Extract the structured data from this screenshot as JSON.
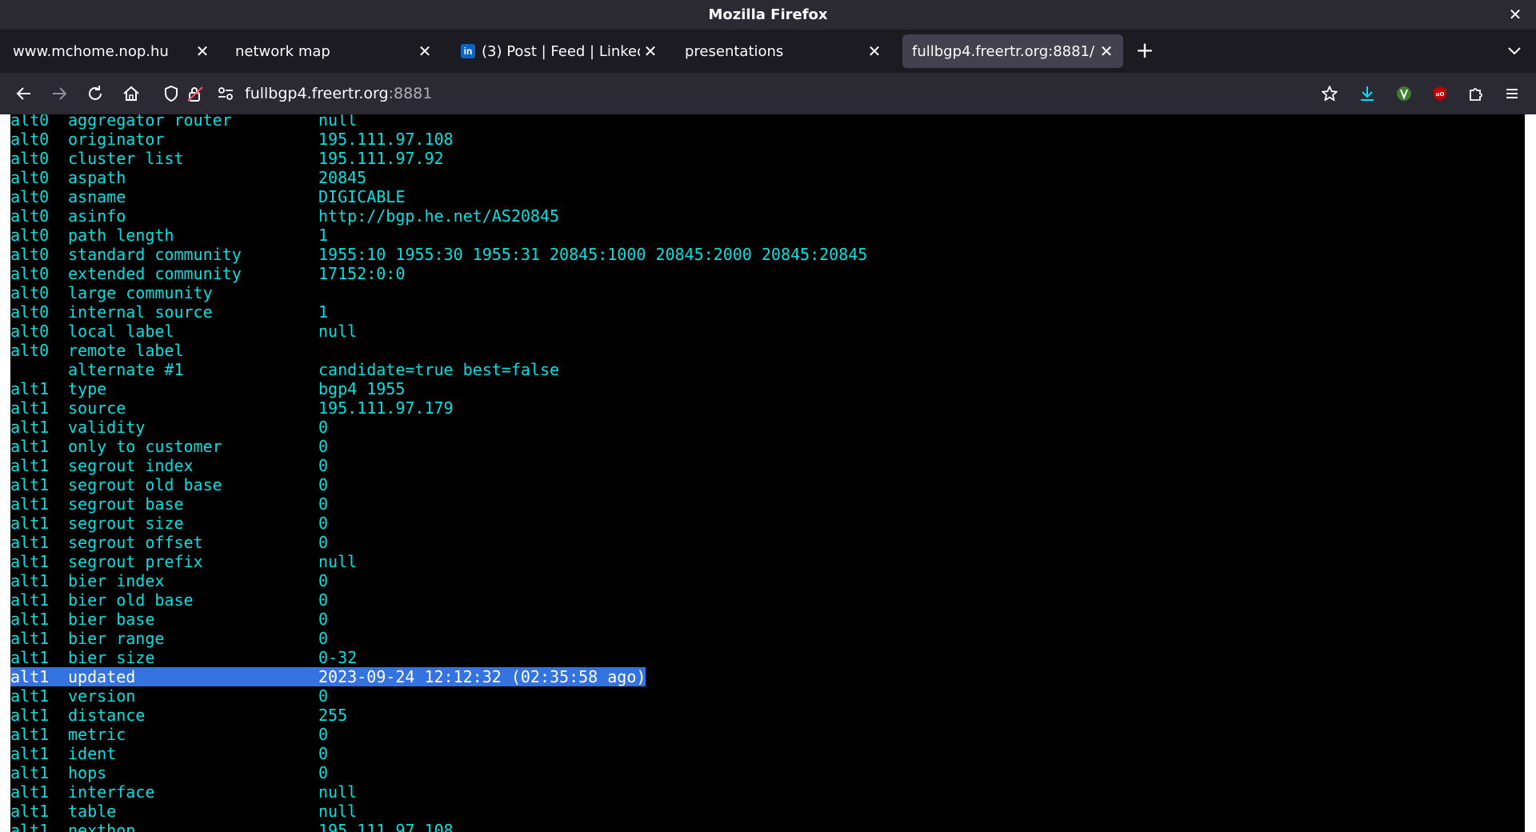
{
  "window": {
    "title": "Mozilla Firefox"
  },
  "tabs": [
    {
      "label": "www.mchome.nop.hu"
    },
    {
      "label": "network map"
    },
    {
      "label": "(3) Post | Feed | LinkedIn",
      "favicon": "in"
    },
    {
      "label": "presentations"
    },
    {
      "label": "fullbgp4.freertr.org:8881/",
      "active": true
    }
  ],
  "address": {
    "host": "fullbgp4.freertr.org",
    "port": ":8881"
  },
  "theme": {
    "terminal_fg": "#00e0e0",
    "terminal_bg": "#000000",
    "selection": "#3574e0"
  },
  "terminal": {
    "lines": [
      {
        "prefix": "alt0",
        "key": "aggregator router",
        "value": "null"
      },
      {
        "prefix": "alt0",
        "key": "originator",
        "value": "195.111.97.108"
      },
      {
        "prefix": "alt0",
        "key": "cluster list",
        "value": "195.111.97.92"
      },
      {
        "prefix": "alt0",
        "key": "aspath",
        "value": "20845"
      },
      {
        "prefix": "alt0",
        "key": "asname",
        "value": "DIGICABLE"
      },
      {
        "prefix": "alt0",
        "key": "asinfo",
        "value": "http://bgp.he.net/AS20845"
      },
      {
        "prefix": "alt0",
        "key": "path length",
        "value": "1"
      },
      {
        "prefix": "alt0",
        "key": "standard community",
        "value": "1955:10 1955:30 1955:31 20845:1000 20845:2000 20845:20845"
      },
      {
        "prefix": "alt0",
        "key": "extended community",
        "value": "17152:0:0"
      },
      {
        "prefix": "alt0",
        "key": "large community",
        "value": ""
      },
      {
        "prefix": "alt0",
        "key": "internal source",
        "value": "1"
      },
      {
        "prefix": "alt0",
        "key": "local label",
        "value": "null"
      },
      {
        "prefix": "alt0",
        "key": "remote label",
        "value": ""
      },
      {
        "prefix": "",
        "key": "alternate #1",
        "value": "candidate=true best=false"
      },
      {
        "prefix": "alt1",
        "key": "type",
        "value": "bgp4 1955"
      },
      {
        "prefix": "alt1",
        "key": "source",
        "value": "195.111.97.179"
      },
      {
        "prefix": "alt1",
        "key": "validity",
        "value": "0"
      },
      {
        "prefix": "alt1",
        "key": "only to customer",
        "value": "0"
      },
      {
        "prefix": "alt1",
        "key": "segrout index",
        "value": "0"
      },
      {
        "prefix": "alt1",
        "key": "segrout old base",
        "value": "0"
      },
      {
        "prefix": "alt1",
        "key": "segrout base",
        "value": "0"
      },
      {
        "prefix": "alt1",
        "key": "segrout size",
        "value": "0"
      },
      {
        "prefix": "alt1",
        "key": "segrout offset",
        "value": "0"
      },
      {
        "prefix": "alt1",
        "key": "segrout prefix",
        "value": "null"
      },
      {
        "prefix": "alt1",
        "key": "bier index",
        "value": "0"
      },
      {
        "prefix": "alt1",
        "key": "bier old base",
        "value": "0"
      },
      {
        "prefix": "alt1",
        "key": "bier base",
        "value": "0"
      },
      {
        "prefix": "alt1",
        "key": "bier range",
        "value": "0"
      },
      {
        "prefix": "alt1",
        "key": "bier size",
        "value": "0-32"
      },
      {
        "prefix": "alt1",
        "key": "updated",
        "value": "2023-09-24 12:12:32 (02:35:58 ago)",
        "selected": true
      },
      {
        "prefix": "alt1",
        "key": "version",
        "value": "0"
      },
      {
        "prefix": "alt1",
        "key": "distance",
        "value": "255"
      },
      {
        "prefix": "alt1",
        "key": "metric",
        "value": "0"
      },
      {
        "prefix": "alt1",
        "key": "ident",
        "value": "0"
      },
      {
        "prefix": "alt1",
        "key": "hops",
        "value": "0"
      },
      {
        "prefix": "alt1",
        "key": "interface",
        "value": "null"
      },
      {
        "prefix": "alt1",
        "key": "table",
        "value": "null"
      },
      {
        "prefix": "alt1",
        "key": "nexthop",
        "value": "195.111.97.108"
      }
    ]
  }
}
